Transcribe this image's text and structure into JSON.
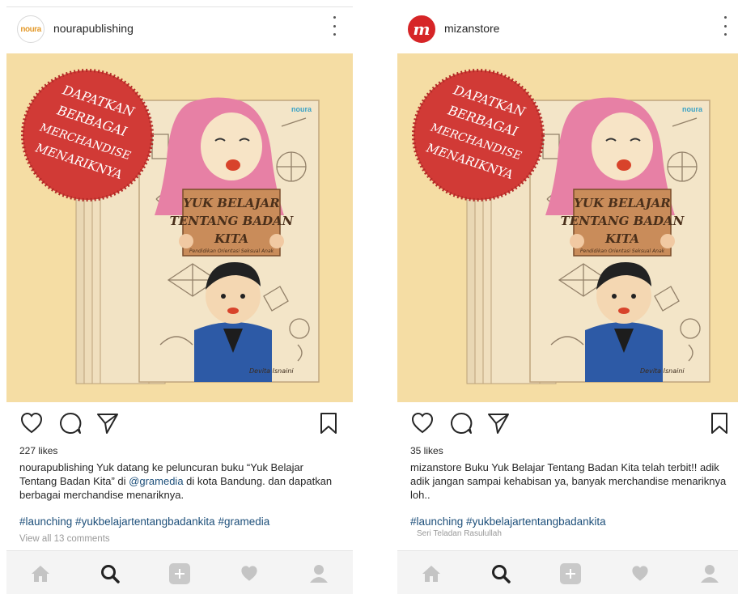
{
  "posts": [
    {
      "id": "left",
      "username": "nourapublishing",
      "avatar_text": "noura",
      "likes": "227 likes",
      "caption_user": "nourapublishing",
      "caption_part1": " Yuk datang ke peluncuran buku “Yuk Belajar Tentang Badan Kita” di ",
      "caption_mention": "@gramedia",
      "caption_part2": " di kota Bandung. dan dapatkan berbagai merchandise menariknya.",
      "hashtags": "#launching #yukbelajartentangbadankita #gramedia",
      "comments": "View all 13 comments",
      "ghost_text": ""
    },
    {
      "id": "right",
      "username": "mizanstore",
      "avatar_text": "m",
      "likes": "35 likes",
      "caption_user": "mizanstore",
      "caption_part1": " Buku Yuk Belajar Tentang Badan Kita telah terbit!! adik adik jangan sampai kehabisan ya, banyak merchandise menariknya loh..",
      "caption_mention": "",
      "caption_part2": "",
      "hashtags": "#launching #yukbelajartentangbadankita",
      "comments": "",
      "ghost_text": "Seri Teladan Rasulullah"
    }
  ],
  "photo": {
    "stamp_lines": [
      "DAPATKAN",
      "BERBAGAI",
      "MERCHANDISE",
      "MENARIKNYA"
    ],
    "book_title_lines": [
      "YUK BELAJAR",
      "TENTANG BADAN",
      "KITA"
    ],
    "book_subtitle": "Pendidikan Orientasi Seksual Anak",
    "book_author": "Devita Isnaini",
    "publisher_logo": "noura"
  },
  "icons": {
    "like": "heart-outline-icon",
    "comment": "comment-bubble-icon",
    "share": "paper-plane-icon",
    "save": "bookmark-icon",
    "nav": [
      "home-icon",
      "search-icon",
      "add-post-icon",
      "activity-heart-icon",
      "profile-icon"
    ]
  },
  "colors": {
    "photo_bg": "#f5dda4",
    "stamp_red": "#d13a36",
    "hashtag_blue": "#1d4f7a",
    "pink_hijab": "#e780a5"
  }
}
